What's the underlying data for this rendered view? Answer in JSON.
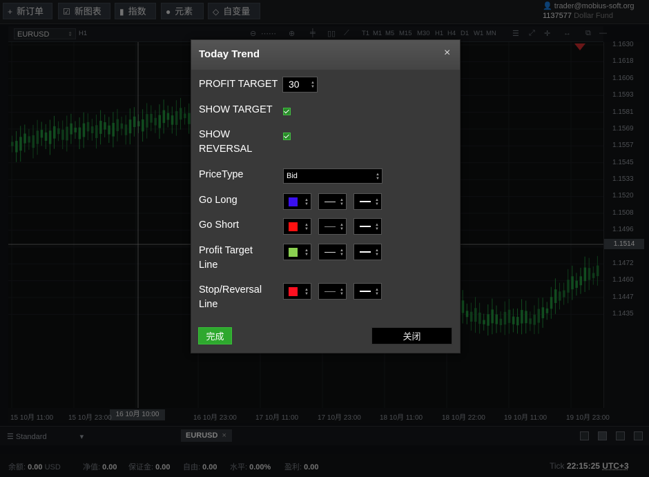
{
  "toolbar": {
    "new_order": "新订单",
    "new_chart": "新图表",
    "indicators": "指数",
    "elements": "元素",
    "variables": "自变量"
  },
  "account": {
    "email": "trader@mobius-soft.org",
    "id": "1137577",
    "fund": "Dollar Fund"
  },
  "chart": {
    "symbol": "EURUSD",
    "period": "H1",
    "timeframes": [
      "T1",
      "M1",
      "M5",
      "M15",
      "M30",
      "H1",
      "H4",
      "D1",
      "W1",
      "MN"
    ],
    "price_labels": [
      "1.1630",
      "1.1618",
      "1.1606",
      "1.1593",
      "1.1581",
      "1.1569",
      "1.1557",
      "1.1545",
      "1.1533",
      "1.1520",
      "1.1508",
      "1.1496",
      "1.1484",
      "1.1472",
      "1.1460",
      "1.1447",
      "1.1435"
    ],
    "current_price": "1.1514",
    "time_labels": [
      "15 10月 11:00",
      "15 10月 23:00",
      "16 10月 10:00",
      "16 10月 23:00",
      "17 10月 11:00",
      "17 10月 23:00",
      "18 10月 11:00",
      "18 10月 22:00",
      "19 10月 11:00",
      "19 10月 23:00"
    ],
    "crosshair_time": "16 10月 10:00",
    "colors": {
      "up": "#1f8a3a",
      "down": "#1a6b2e",
      "grid": "#1a1d20",
      "crosshair": "#8a8a8a"
    }
  },
  "tabs": {
    "layout": "Standard",
    "active_tab": "EURUSD",
    "close": "×"
  },
  "status": {
    "balance_label": "余额:",
    "balance_value": "0.00",
    "currency": "USD",
    "equity_label": "净值:",
    "equity_value": "0.00",
    "margin_label": "保证金:",
    "margin_value": "0.00",
    "free_label": "自由:",
    "free_value": "0.00",
    "level_label": "水平:",
    "level_value": "0.00%",
    "profit_label": "盈利:",
    "profit_value": "0.00",
    "tick_label": "Tick",
    "time": "22:15:25",
    "tz": "UTC+3"
  },
  "dialog": {
    "title": "Today Trend",
    "close": "×",
    "profit_target_label": "PROFIT TARGET",
    "profit_target_value": "30",
    "show_target_label": "SHOW TARGET",
    "show_reversal_label_1": "SHOW",
    "show_reversal_label_2": "REVERSAL",
    "price_type_label": "PriceType",
    "price_type_value": "Bid",
    "go_long_label": "Go Long",
    "go_short_label": "Go Short",
    "profit_line_label_1": "Profit Target",
    "profit_line_label_2": "Line",
    "stop_line_label_1": "Stop/Reversal",
    "stop_line_label_2": "Line",
    "colors": {
      "go_long": "#3a10f0",
      "go_short": "#ff1010",
      "profit_target_line": "#8ad050",
      "stop_reversal_line": "#ff1020"
    },
    "done_label": "完成",
    "close_label": "关闭"
  }
}
